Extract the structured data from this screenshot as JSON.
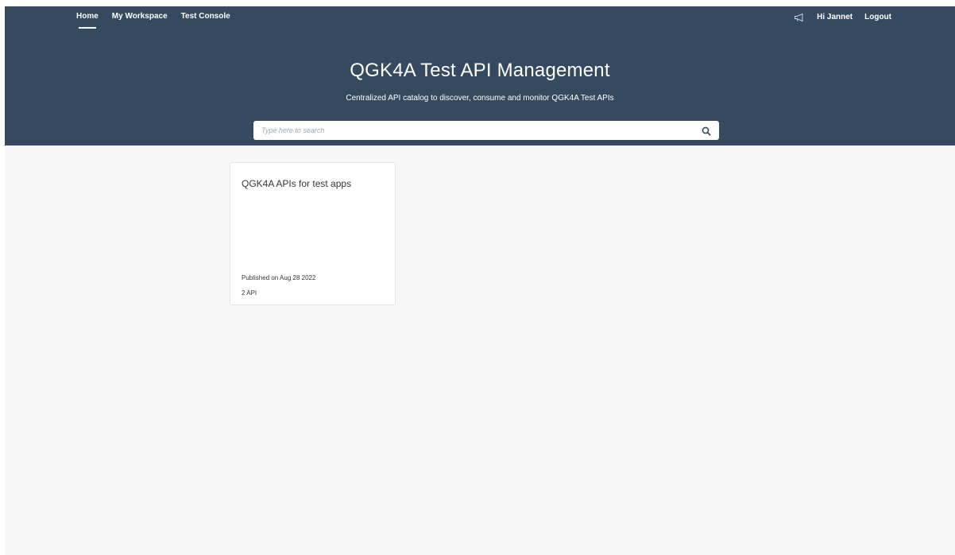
{
  "nav": {
    "left": [
      {
        "label": "Home",
        "active": true
      },
      {
        "label": "My Workspace",
        "active": false
      },
      {
        "label": "Test Console",
        "active": false
      }
    ],
    "right": {
      "announcement_icon": "megaphone-icon",
      "greeting": "Hi Jannet",
      "logout": "Logout"
    }
  },
  "hero": {
    "title": "QGK4A Test API Management",
    "subtitle": "Centralized API catalog to discover, consume and monitor QGK4A Test APIs",
    "background_color": "#354a5f"
  },
  "search": {
    "placeholder": "Type here to search",
    "value": "",
    "icon": "search-icon"
  },
  "products": [
    {
      "title": "QGK4A APIs for test apps",
      "published": "Published on Aug 28 2022",
      "api_count": "2 API"
    }
  ]
}
